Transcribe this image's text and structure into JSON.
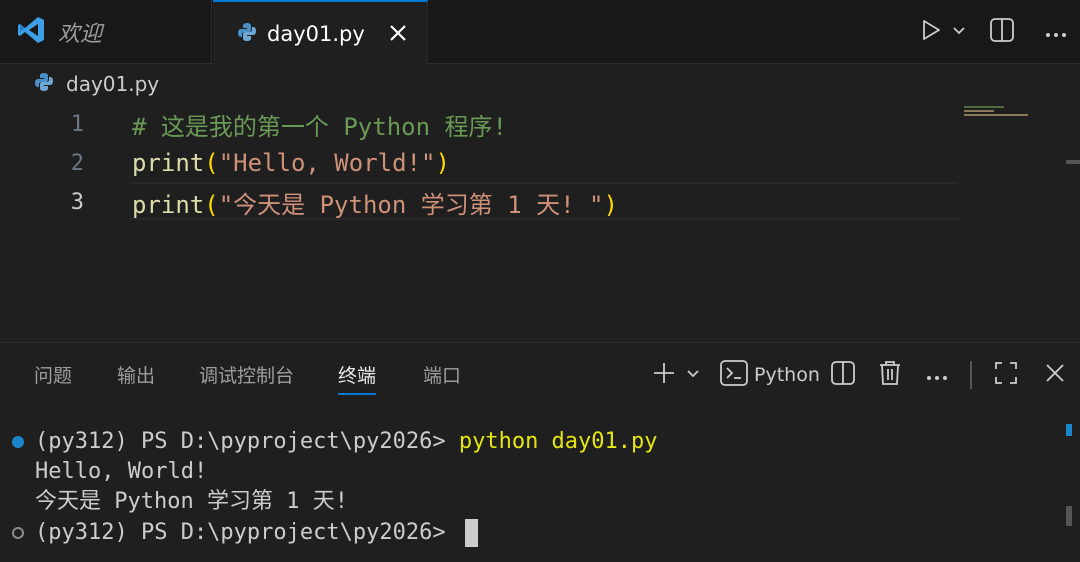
{
  "tabs": [
    {
      "label": "欢迎",
      "icon": "vscode-logo-icon"
    },
    {
      "label": "day01.py",
      "icon": "python-file-icon"
    }
  ],
  "breadcrumb": {
    "file": "day01.py"
  },
  "editor": {
    "line_numbers": [
      "1",
      "2",
      "3"
    ],
    "lines": [
      [
        {
          "t": "comment",
          "v": "# 这是我的第一个 Python 程序!"
        }
      ],
      [
        {
          "t": "func",
          "v": "print"
        },
        {
          "t": "paren",
          "v": "("
        },
        {
          "t": "str",
          "v": "\"Hello, World!\""
        },
        {
          "t": "paren",
          "v": ")"
        }
      ],
      [
        {
          "t": "func",
          "v": "print"
        },
        {
          "t": "paren",
          "v": "("
        },
        {
          "t": "str",
          "v": "\"今天是 Python 学习第 1 天! \""
        },
        {
          "t": "paren",
          "v": ")"
        }
      ]
    ]
  },
  "panel": {
    "tabs": [
      "问题",
      "输出",
      "调试控制台",
      "终端",
      "端口"
    ],
    "active_tab": "终端",
    "terminal_profile": "Python"
  },
  "terminal": {
    "prompt": "(py312) PS D:\\pyproject\\py2026> ",
    "command": "python day01.py",
    "output": [
      "Hello, World!",
      "今天是 Python 学习第 1 天!"
    ]
  },
  "colors": {
    "accent": "#0078d4",
    "comment": "#6a9955",
    "function": "#dcdcaa",
    "string": "#ce9178",
    "bracket": "#ffd700",
    "command": "#e5e510"
  }
}
